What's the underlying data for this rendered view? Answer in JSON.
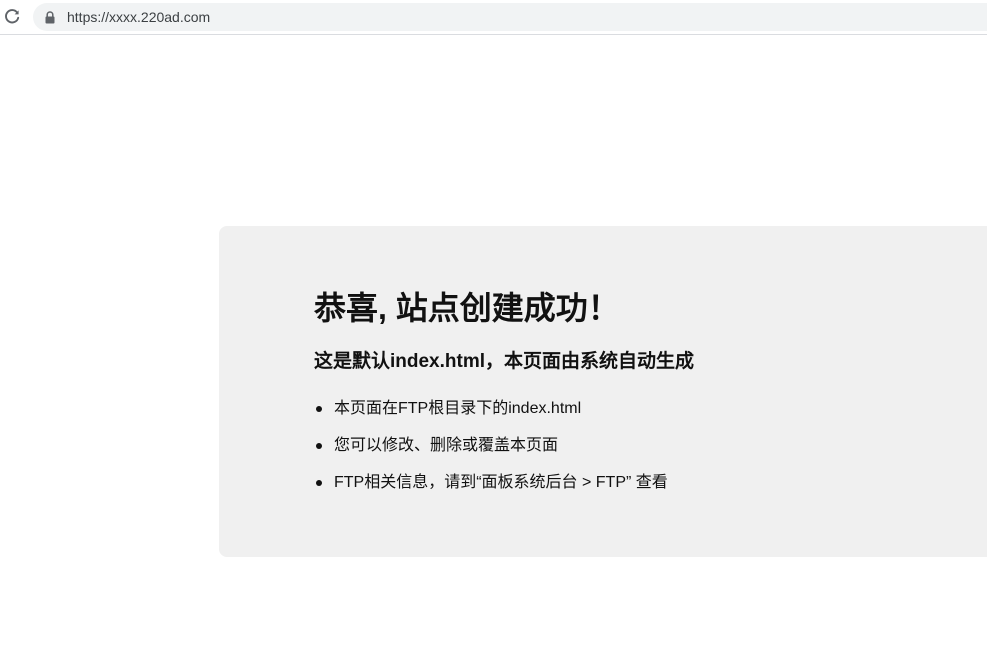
{
  "browser": {
    "url": "https://xxxx.220ad.com",
    "reload_icon": "reload-icon",
    "lock_icon": "lock-icon"
  },
  "card": {
    "title": "恭喜, 站点创建成功！",
    "subtitle": "这是默认index.html，本页面由系统自动生成",
    "items": [
      "本页面在FTP根目录下的index.html",
      "您可以修改、删除或覆盖本页面",
      "FTP相关信息，请到“面板系统后台 > FTP” 查看"
    ]
  },
  "colors": {
    "card_background": "#f0f0f0",
    "omnibox_background": "#f1f3f4",
    "text": "#111111"
  }
}
